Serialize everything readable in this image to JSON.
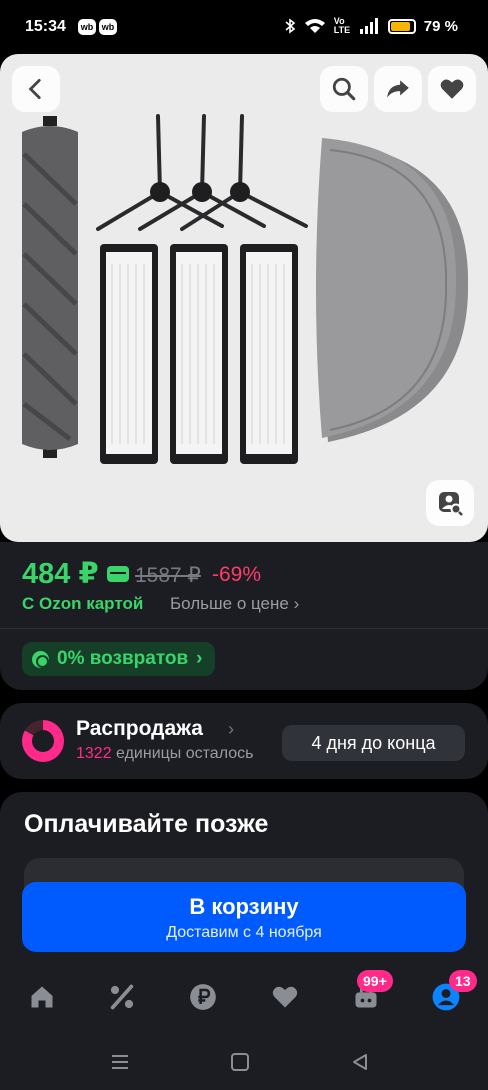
{
  "status_bar": {
    "time": "15:34",
    "app_badges": [
      "wb",
      "wb"
    ],
    "network": "Vo LTE",
    "battery_percent": "79 %",
    "battery_level": 0.79,
    "battery_color": "#f7b500"
  },
  "gallery": {
    "back_icon": "chevron-left-icon",
    "actions": [
      "search-icon",
      "share-icon",
      "heart-icon"
    ],
    "image_search_icon": "image-search-icon"
  },
  "price": {
    "current": "484 ₽",
    "old": "1587 ₽",
    "discount": "-69%",
    "ozon_card_label": "С Ozon картой",
    "more_about_price": "Больше о цене",
    "returns_badge": "0% возвратов",
    "accent_green": "#3ad46a",
    "discount_color": "#ff3b6b"
  },
  "sale": {
    "title": "Распродажа",
    "remaining_count": "1322",
    "remaining_text": " единицы осталось",
    "deadline": "4 дня до конца",
    "accent_pink": "#ff2a8a"
  },
  "pay_later": {
    "title": "Оплачивайте позже"
  },
  "cart_button": {
    "label": "В корзину",
    "delivery": "Доставим с 4 ноября",
    "color": "#005bff"
  },
  "tab_bar": {
    "tabs": [
      "home-icon",
      "percent-icon",
      "ruble-icon",
      "heart-icon",
      "cart-icon",
      "profile-icon"
    ],
    "cart_badge": "99+",
    "profile_badge": "13"
  },
  "nav_bar": {
    "buttons": [
      "menu-icon",
      "home-square-icon",
      "back-triangle-icon"
    ]
  }
}
